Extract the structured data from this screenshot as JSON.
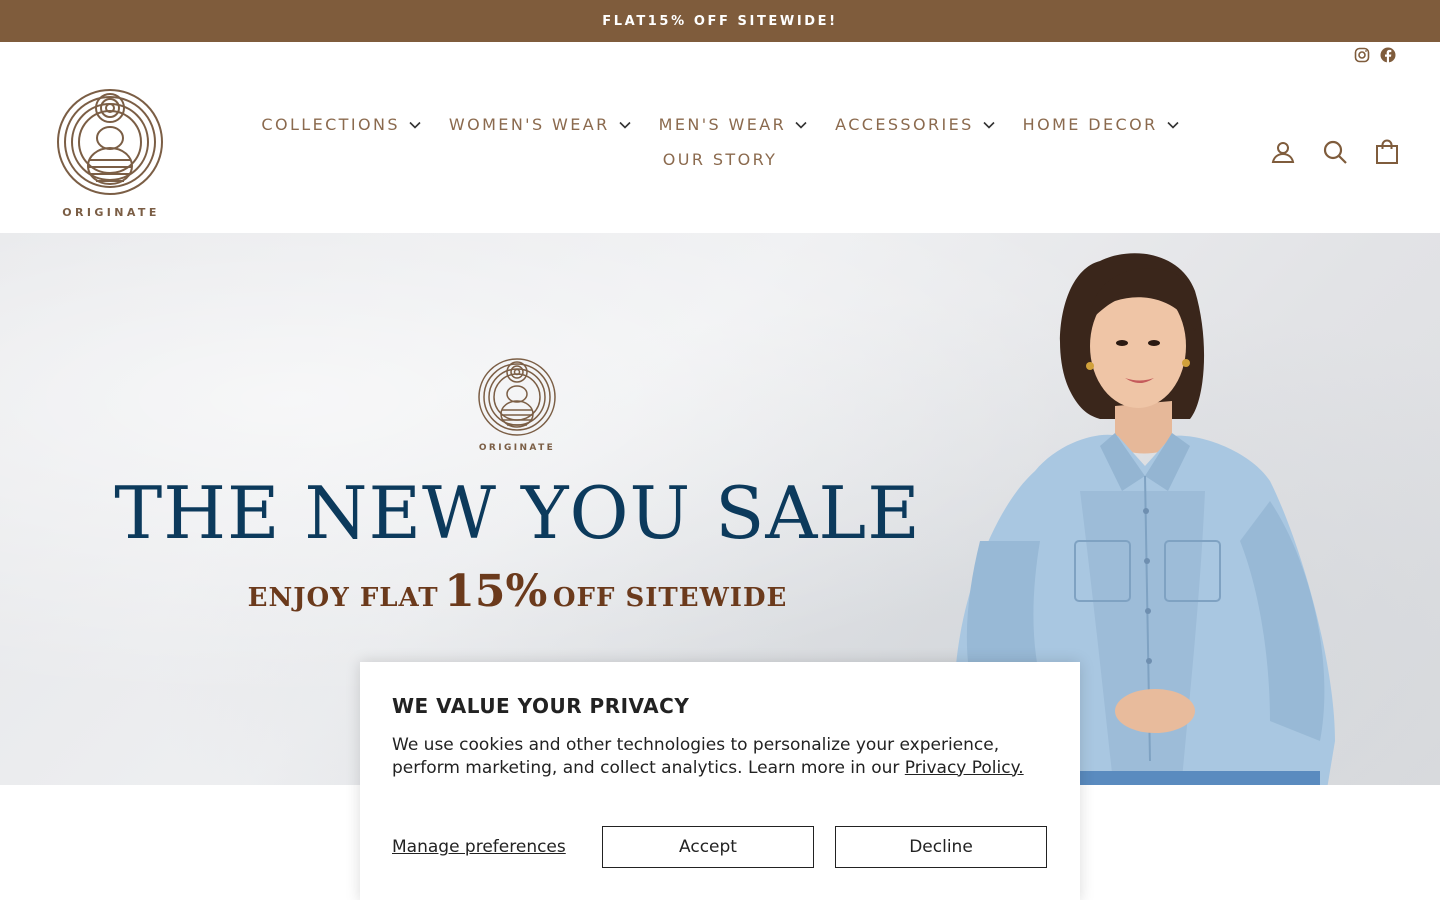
{
  "announcement": {
    "text": "FLAT15% OFF SITEWIDE!"
  },
  "brand": {
    "name": "ORIGINATE",
    "color": "#7b5e45",
    "accent": "#7f5c3c"
  },
  "social": {
    "icons": [
      "instagram-icon",
      "facebook-icon"
    ]
  },
  "nav": {
    "items": [
      {
        "label": "COLLECTIONS",
        "dropdown": true
      },
      {
        "label": "WOMEN'S WEAR",
        "dropdown": true
      },
      {
        "label": "MEN'S WEAR",
        "dropdown": true
      },
      {
        "label": "ACCESSORIES",
        "dropdown": true
      },
      {
        "label": "HOME DECOR",
        "dropdown": true
      },
      {
        "label": "OUR STORY",
        "dropdown": false
      }
    ]
  },
  "header_icons": [
    "account-icon",
    "search-icon",
    "bag-icon"
  ],
  "hero": {
    "brand": "ORIGINATE",
    "title": "THE NEW YOU SALE",
    "subtitle_prefix": "ENJOY FLAT",
    "subtitle_value": "15%",
    "subtitle_suffix": "OFF SITEWIDE",
    "title_color": "#0c3a5c",
    "subtitle_color": "#6b3a1c"
  },
  "cookie": {
    "title": "WE VALUE YOUR PRIVACY",
    "body": "We use cookies and other technologies to personalize your experience, perform marketing, and collect analytics. Learn more in our",
    "link": "Privacy Policy.",
    "manage": "Manage preferences",
    "accept": "Accept",
    "decline": "Decline"
  }
}
